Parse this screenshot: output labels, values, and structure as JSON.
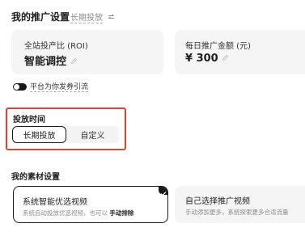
{
  "header": {
    "title": "我的推广设置",
    "mode": "长期投放"
  },
  "metrics": {
    "roi": {
      "label": "全站投产比 (ROI)",
      "value": "智能调控"
    },
    "budget": {
      "label": "每日推广金额 (元)",
      "currency": "¥",
      "value": "300"
    }
  },
  "coupon_toggle": {
    "label": "平台为你发券引流",
    "enabled": true
  },
  "schedule": {
    "title": "投放时间",
    "options": [
      "长期投放",
      "自定义"
    ],
    "selected": "长期投放"
  },
  "materials": {
    "title": "我的素材设置",
    "cards": [
      {
        "title": "系统智能优选视频",
        "desc_prefix": "系统自动投放优选视频，也可以",
        "desc_action": "手动排除",
        "selected": true
      },
      {
        "title": "自己选择推广视频",
        "desc": "手动添加更多，系统探索更多合适流量",
        "selected": false
      }
    ]
  },
  "colors": {
    "highlight_border": "#e8402f",
    "selected_border": "#1a1a1a",
    "card_bg": "#f5f5f6"
  }
}
